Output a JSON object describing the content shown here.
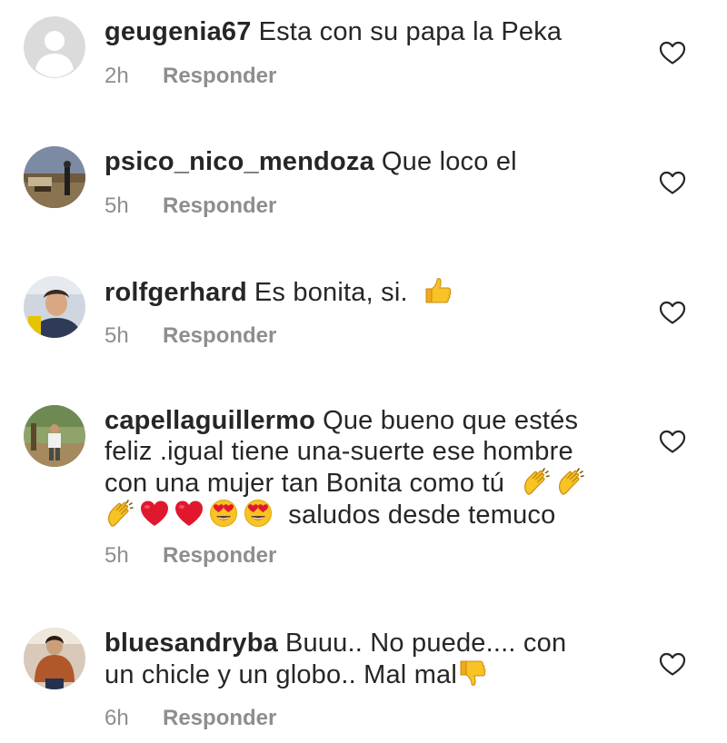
{
  "comments": [
    {
      "username": "geugenia67",
      "text": "Esta con su papa la Peka",
      "time": "2h",
      "reply_label": "Responder"
    },
    {
      "username": "psico_nico_mendoza",
      "text": "Que loco el",
      "time": "5h",
      "reply_label": "Responder"
    },
    {
      "username": "rolfgerhard",
      "text": "Es bonita, si.",
      "time": "5h",
      "reply_label": "Responder"
    },
    {
      "username": "capellaguillermo",
      "text_line1": "Que bueno que estés",
      "text_line2": "feliz .igual tiene una-suerte ese hombre",
      "text_line3": "con una mujer tan Bonita como tú",
      "text_line4": "saludos desde temuco",
      "time": "5h",
      "reply_label": "Responder"
    },
    {
      "username": "bluesandryba",
      "text_line1": "Buuu.. No puede.... con",
      "text_line2": "un chicle y un globo.. Mal mal",
      "time": "6h",
      "reply_label": "Responder"
    }
  ],
  "icons": {
    "like": "heart-outline-icon",
    "default_avatar": "default-avatar-icon",
    "emoji_thumbs_up": "thumbs-up-emoji",
    "emoji_clap": "clapping-hands-emoji",
    "emoji_heart": "red-heart-emoji",
    "emoji_heart_eyes": "heart-eyes-emoji",
    "emoji_thumbs_down": "thumbs-down-emoji"
  },
  "colors": {
    "text": "#262626",
    "meta": "#8e8e8e",
    "emoji_yellow": "#f7c325",
    "emoji_red": "#e0182e"
  }
}
